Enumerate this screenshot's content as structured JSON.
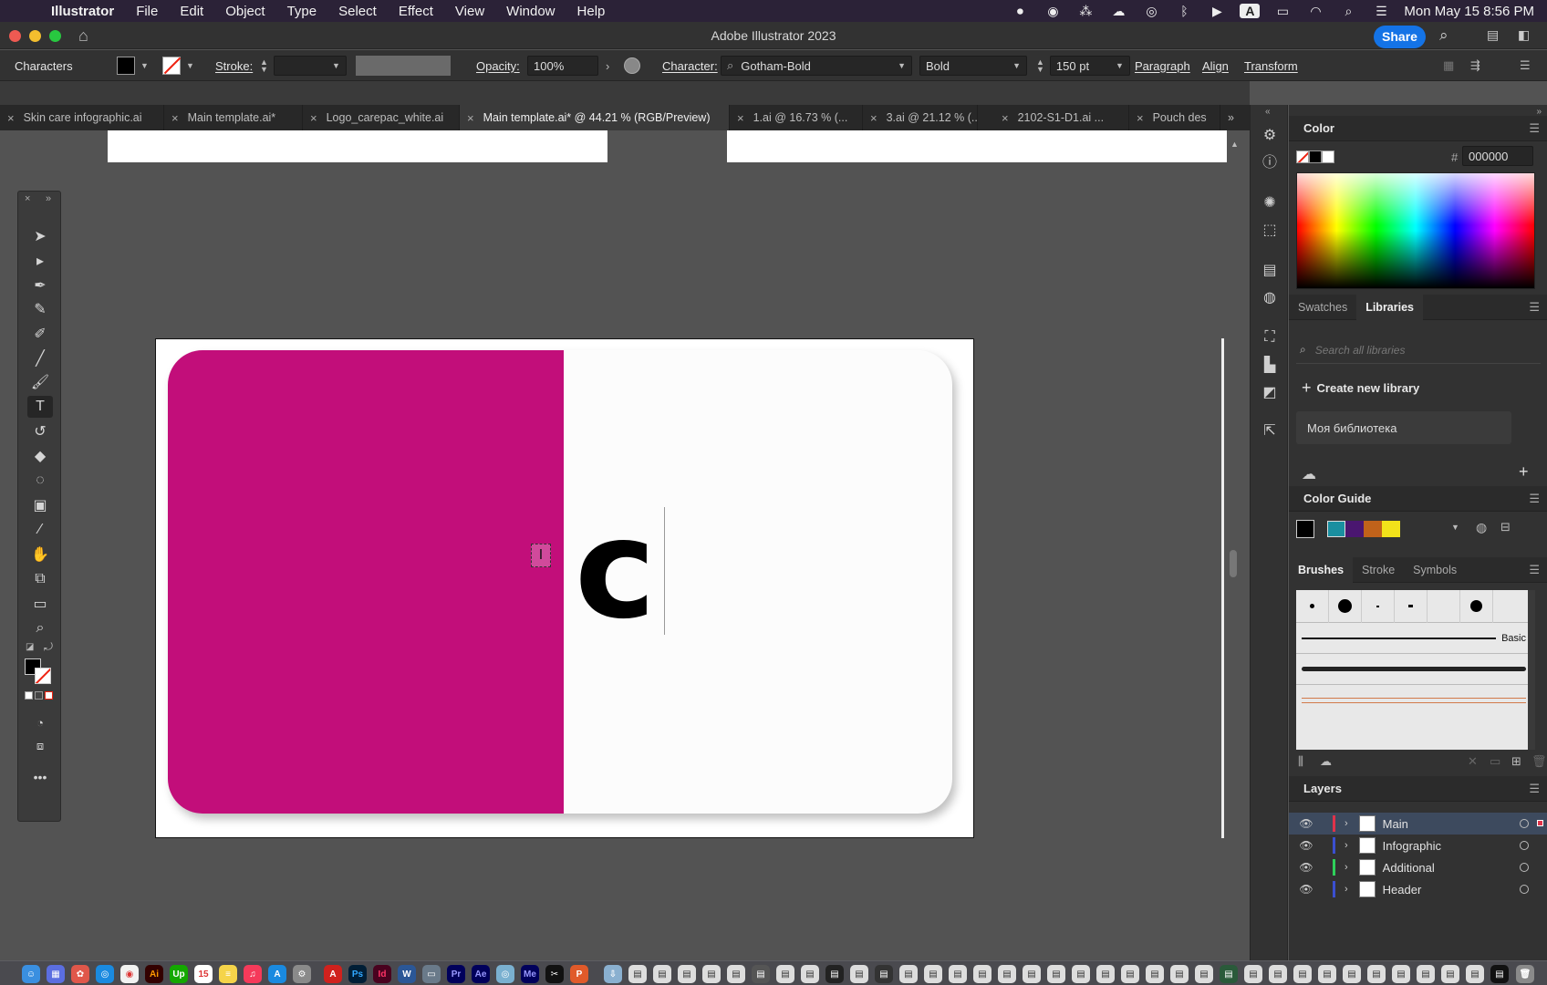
{
  "menubar": {
    "app": "Illustrator",
    "items": [
      "File",
      "Edit",
      "Object",
      "Type",
      "Select",
      "Effect",
      "View",
      "Window",
      "Help"
    ],
    "datetime": "Mon May 15  8:56 PM"
  },
  "titlebar": {
    "title": "Adobe Illustrator 2023",
    "share": "Share"
  },
  "control": {
    "selection": "Characters",
    "stroke_label": "Stroke:",
    "opacity_label": "Opacity:",
    "opacity_value": "100%",
    "character_label": "Character:",
    "font_family": "Gotham-Bold",
    "font_style": "Bold",
    "font_size": "150 pt",
    "paragraph": "Paragraph",
    "align": "Align",
    "transform": "Transform"
  },
  "tabs": [
    {
      "label": "Skin care infographic.ai",
      "active": false
    },
    {
      "label": "Main template.ai*",
      "active": false
    },
    {
      "label": "Logo_carepac_white.ai",
      "active": false
    },
    {
      "label": "Main template.ai* @ 44.21 % (RGB/Preview)",
      "active": true
    },
    {
      "label": "1.ai @ 16.73 % (...",
      "active": false
    },
    {
      "label": "3.ai @ 21.12 % (...",
      "active": false
    },
    {
      "label": "2102-S1-D1.ai ...",
      "active": false
    },
    {
      "label": "Pouch des",
      "active": false
    }
  ],
  "canvas": {
    "text_content": "c",
    "card_left_color": "#c20e7a"
  },
  "color_panel": {
    "title": "Color",
    "hex_label": "#",
    "hex": "000000"
  },
  "libraries_panel": {
    "tabs": [
      "Swatches",
      "Libraries"
    ],
    "active_tab": "Libraries",
    "search_placeholder": "Search all libraries",
    "create": "Create new library",
    "library": "Моя библиотека"
  },
  "color_guide": {
    "title": "Color Guide",
    "swatches": [
      "#000000",
      "#1a8fa0",
      "#4a1670",
      "#c0621a",
      "#f2e21a"
    ]
  },
  "brushes_panel": {
    "tabs": [
      "Brushes",
      "Stroke",
      "Symbols"
    ],
    "active_tab": "Brushes",
    "basic_label": "Basic"
  },
  "layers_panel": {
    "title": "Layers",
    "layers": [
      {
        "name": "Main",
        "color": "#e0334a",
        "selected": true
      },
      {
        "name": "Infographic",
        "color": "#3a4fd0",
        "selected": false
      },
      {
        "name": "Additional",
        "color": "#2ed05a",
        "selected": false
      },
      {
        "name": "Header",
        "color": "#3a4fd0",
        "selected": false
      }
    ]
  }
}
